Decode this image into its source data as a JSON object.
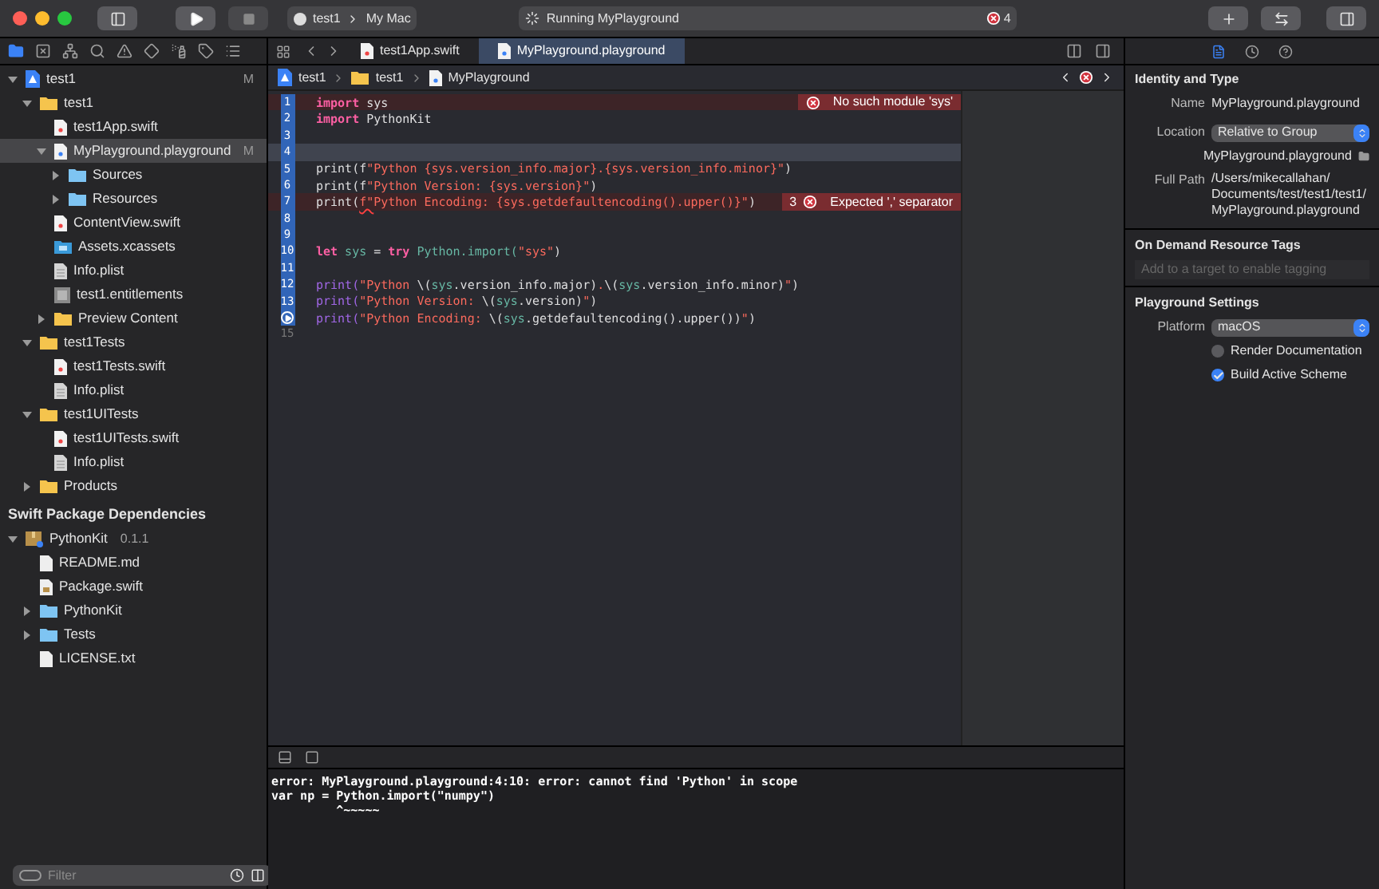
{
  "toolbar": {
    "scheme": "test1",
    "destination": "My Mac",
    "activity": "Running MyPlayground",
    "error_count": "4"
  },
  "navigator": {
    "tree": [
      {
        "name": "test1",
        "kind": "project",
        "badge": "M",
        "selected": false,
        "expanded": true,
        "children": [
          {
            "name": "test1",
            "kind": "folder",
            "selected": false,
            "expanded": true,
            "children": [
              {
                "name": "test1App.swift",
                "kind": "swift",
                "selected": false
              },
              {
                "name": "MyPlayground.playground",
                "kind": "playground",
                "badge": "M",
                "selected": true,
                "expanded": true,
                "children": [
                  {
                    "name": "Sources",
                    "kind": "bluefolder",
                    "selected": false,
                    "expanded": false
                  },
                  {
                    "name": "Resources",
                    "kind": "bluefolder",
                    "selected": false,
                    "expanded": false
                  }
                ]
              },
              {
                "name": "ContentView.swift",
                "kind": "swift",
                "selected": false
              },
              {
                "name": "Assets.xcassets",
                "kind": "assets",
                "selected": false
              },
              {
                "name": "Info.plist",
                "kind": "plist",
                "selected": false
              },
              {
                "name": "test1.entitlements",
                "kind": "entitlements",
                "selected": false
              },
              {
                "name": "Preview Content",
                "kind": "folder",
                "selected": false,
                "expanded": false
              }
            ]
          },
          {
            "name": "test1Tests",
            "kind": "folder",
            "selected": false,
            "expanded": true,
            "children": [
              {
                "name": "test1Tests.swift",
                "kind": "swift",
                "selected": false
              },
              {
                "name": "Info.plist",
                "kind": "plist",
                "selected": false
              }
            ]
          },
          {
            "name": "test1UITests",
            "kind": "folder",
            "selected": false,
            "expanded": true,
            "children": [
              {
                "name": "test1UITests.swift",
                "kind": "swift",
                "selected": false
              },
              {
                "name": "Info.plist",
                "kind": "plist",
                "selected": false
              }
            ]
          },
          {
            "name": "Products",
            "kind": "folder",
            "selected": false,
            "expanded": false
          }
        ]
      }
    ],
    "section": "Swift Package Dependencies",
    "packages": [
      {
        "name": "PythonKit",
        "version": "0.1.1",
        "kind": "package",
        "selected": false,
        "expanded": true,
        "children": [
          {
            "name": "README.md",
            "kind": "doc",
            "selected": false
          },
          {
            "name": "Package.swift",
            "kind": "package-file",
            "selected": false
          },
          {
            "name": "PythonKit",
            "kind": "bluefolder",
            "selected": false,
            "expanded": false
          },
          {
            "name": "Tests",
            "kind": "bluefolder",
            "selected": false,
            "expanded": false
          },
          {
            "name": "LICENSE.txt",
            "kind": "doc",
            "selected": false
          }
        ]
      }
    ],
    "filter": {
      "placeholder": "Filter"
    }
  },
  "editor_tabs": [
    {
      "label": "test1App.swift",
      "kind": "swift",
      "selected": false
    },
    {
      "label": "MyPlayground.playground",
      "kind": "playground",
      "selected": true
    }
  ],
  "breadcrumb": [
    {
      "label": "test1",
      "kind": "project"
    },
    {
      "label": "test1",
      "kind": "folder"
    },
    {
      "label": "MyPlayground",
      "kind": "playground"
    }
  ],
  "code": [
    {
      "number": "1",
      "executed": true,
      "error": true,
      "current": false,
      "tokens": [
        {
          "kind": "keyword",
          "text": "import"
        },
        {
          "kind": "plain",
          "text": " sys"
        }
      ],
      "issue": {
        "message": "No such module 'sys'"
      }
    },
    {
      "number": "2",
      "executed": true,
      "error": false,
      "current": false,
      "tokens": [
        {
          "kind": "keyword",
          "text": "import"
        },
        {
          "kind": "plain",
          "text": " PythonKit"
        }
      ]
    },
    {
      "number": "3",
      "executed": true,
      "error": false,
      "current": false
    },
    {
      "number": "4",
      "executed": true,
      "error": false,
      "current": true
    },
    {
      "number": "5",
      "executed": true,
      "error": false,
      "current": false,
      "tokens": [
        {
          "kind": "plain",
          "text": "print(f"
        },
        {
          "kind": "string",
          "text": "\"Python {sys.version_info.major}.{sys.version_info.minor}\""
        },
        {
          "kind": "plain",
          "text": ")"
        }
      ]
    },
    {
      "number": "6",
      "executed": true,
      "error": false,
      "current": false,
      "tokens": [
        {
          "kind": "plain",
          "text": "print(f"
        },
        {
          "kind": "string",
          "text": "\"Python Version: {sys.version}\""
        },
        {
          "kind": "plain",
          "text": ")"
        }
      ]
    },
    {
      "number": "7",
      "executed": true,
      "error": true,
      "current": false,
      "tokens": [
        {
          "kind": "plain",
          "text": "print("
        },
        {
          "kind": "squiggle",
          "text": "f\""
        },
        {
          "kind": "string",
          "text": "Python Encoding: {sys.getdefaultencoding().upper()}\""
        },
        {
          "kind": "plain",
          "text": ")"
        }
      ],
      "issue": {
        "count": "3",
        "message": "Expected ',' separator"
      }
    },
    {
      "number": "8",
      "executed": true,
      "error": false,
      "current": false
    },
    {
      "number": "9",
      "executed": true,
      "error": false,
      "current": false
    },
    {
      "number": "10",
      "executed": true,
      "error": false,
      "current": false,
      "tokens": [
        {
          "kind": "keyword",
          "text": "let"
        },
        {
          "kind": "ident",
          "text": " sys"
        },
        {
          "kind": "plain",
          "text": " = "
        },
        {
          "kind": "keyword",
          "text": "try"
        },
        {
          "kind": "ident",
          "text": " Python.import("
        },
        {
          "kind": "string",
          "text": "\"sys\""
        },
        {
          "kind": "plain",
          "text": ")"
        }
      ]
    },
    {
      "number": "11",
      "executed": true,
      "error": false,
      "current": false
    },
    {
      "number": "12",
      "executed": true,
      "error": false,
      "current": false,
      "tokens": [
        {
          "kind": "func",
          "text": "print("
        },
        {
          "kind": "string",
          "text": "\"Python "
        },
        {
          "kind": "plain",
          "text": "\\("
        },
        {
          "kind": "ident",
          "text": "sys"
        },
        {
          "kind": "plain",
          "text": ".version_info.major)"
        },
        {
          "kind": "string",
          "text": "."
        },
        {
          "kind": "plain",
          "text": "\\("
        },
        {
          "kind": "ident",
          "text": "sys"
        },
        {
          "kind": "plain",
          "text": ".version_info.minor)"
        },
        {
          "kind": "string",
          "text": "\""
        },
        {
          "kind": "plain",
          "text": ")"
        }
      ]
    },
    {
      "number": "13",
      "executed": true,
      "error": false,
      "current": false,
      "tokens": [
        {
          "kind": "func",
          "text": "print("
        },
        {
          "kind": "string",
          "text": "\"Python Version: "
        },
        {
          "kind": "plain",
          "text": "\\("
        },
        {
          "kind": "ident",
          "text": "sys"
        },
        {
          "kind": "plain",
          "text": ".version)"
        },
        {
          "kind": "string",
          "text": "\""
        },
        {
          "kind": "plain",
          "text": ")"
        }
      ]
    },
    {
      "kind": "run",
      "executed": true,
      "error": false,
      "current": false,
      "tokens": [
        {
          "kind": "func",
          "text": "print("
        },
        {
          "kind": "string",
          "text": "\"Python Encoding: "
        },
        {
          "kind": "plain",
          "text": "\\("
        },
        {
          "kind": "ident",
          "text": "sys"
        },
        {
          "kind": "plain",
          "text": ".getdefaultencoding().upper())"
        },
        {
          "kind": "string",
          "text": "\""
        },
        {
          "kind": "plain",
          "text": ")"
        }
      ]
    },
    {
      "number": "15",
      "executed": false,
      "error": false,
      "current": false
    }
  ],
  "console": [
    "error: MyPlayground.playground:4:10: error: cannot find 'Python' in scope",
    "var np = Python.import(\"numpy\")",
    "         ^~~~~~"
  ],
  "inspector": {
    "identity": {
      "title": "Identity and Type",
      "name_label": "Name",
      "name": "MyPlayground.playground",
      "location_label": "Location",
      "location": "Relative to Group",
      "location_file": "MyPlayground.playground",
      "path_label": "Full Path",
      "path": [
        "/Users/mikecallahan/",
        "Documents/test/test1/test1/",
        "MyPlayground.playground"
      ]
    },
    "tags": {
      "title": "On Demand Resource Tags",
      "placeholder": "Add to a target to enable tagging"
    },
    "playground": {
      "title": "Playground Settings",
      "platform_label": "Platform",
      "platform": "macOS",
      "options": [
        {
          "label": "Render Documentation",
          "checked": false
        },
        {
          "label": "Build Active Scheme",
          "checked": true
        }
      ]
    }
  }
}
